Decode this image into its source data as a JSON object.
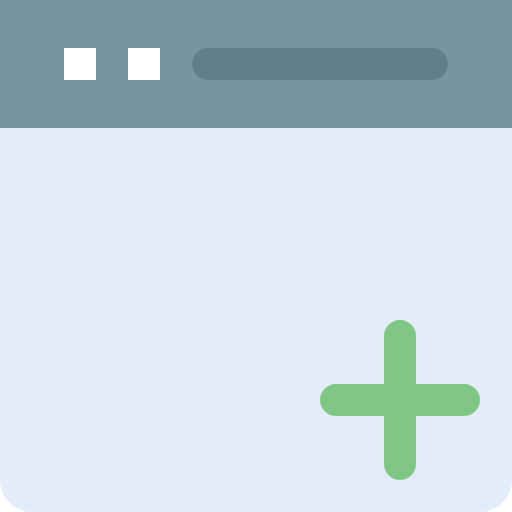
{
  "colors": {
    "titlebar": "#7596A0",
    "body": "#E2ECFB",
    "window_control": "#FFFFFF",
    "address_bar": "#617F89",
    "add_icon": "#80C783"
  },
  "titlebar": {
    "controls": [
      "square-icon",
      "square-icon"
    ],
    "address_bar_icon": "address-bar"
  },
  "main": {
    "action_icon": "plus-icon"
  }
}
